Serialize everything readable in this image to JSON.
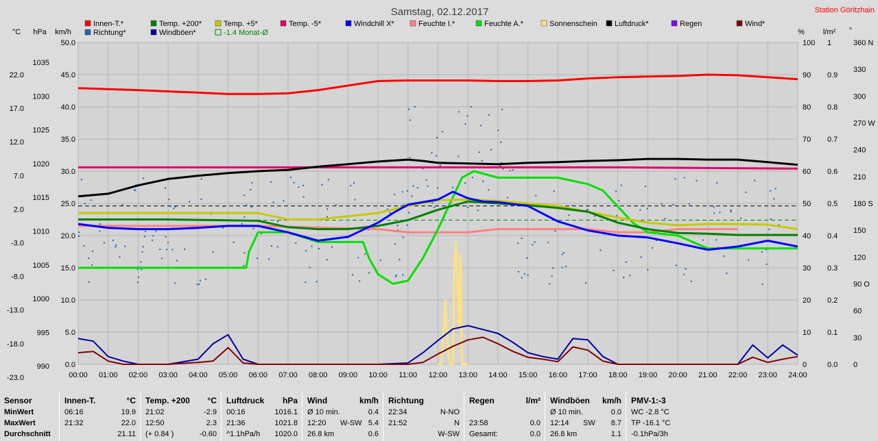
{
  "title": "Samstag, 02.12.2017",
  "station": "Station Göritzhain",
  "colors": {
    "innen": "#ff0000",
    "temp200": "#008000",
    "temp5": "#c8c800",
    "temp_minus5": "#e0006e",
    "windchill": "#0000ff",
    "feuchte_i": "#ff8080",
    "feuchte_a": "#00e000",
    "sonne": "#ffe080",
    "luftdruck": "#000000",
    "regen": "#8000ff",
    "wind": "#800000",
    "richtung": "#1e64b4",
    "windboeen": "#0000a0",
    "monat": "#008000",
    "ref_line": "#000000"
  },
  "legend": [
    {
      "label": "Innen-T.*",
      "color": "#ff0000"
    },
    {
      "label": "Temp. +200*",
      "color": "#008000"
    },
    {
      "label": "Temp. +5*",
      "color": "#c8c800"
    },
    {
      "label": "Temp. -5*",
      "color": "#e0006e"
    },
    {
      "label": "Windchill X*",
      "color": "#0000ff"
    },
    {
      "label": "Feuchte I.*",
      "color": "#ff8080"
    },
    {
      "label": "Feuchte A.*",
      "color": "#00e000"
    },
    {
      "label": "Sonnenschein",
      "color": "#ffe080"
    },
    {
      "label": "Luftdruck*",
      "color": "#000000"
    },
    {
      "label": "Regen",
      "color": "#8000ff"
    },
    {
      "label": "Wind*",
      "color": "#800000"
    },
    {
      "label": "Richtung*",
      "color": "#1e64b4"
    },
    {
      "label": "Windböen*",
      "color": "#0000a0"
    },
    {
      "label": "-1.4 Monat-Ø",
      "color": "#008000"
    }
  ],
  "axes": {
    "left_units": [
      "°C",
      "hPa",
      "km/h"
    ],
    "right_units": [
      "%",
      "l/m²",
      "°"
    ],
    "temp_ticks": [
      "22.0",
      "17.0",
      "12.0",
      "7.0",
      "2.0",
      "-3.0",
      "-8.0",
      "-13.0",
      "-18.0",
      "-23.0"
    ],
    "hpa_ticks": [
      "1035",
      "1030",
      "1025",
      "1020",
      "1015",
      "1010",
      "1005",
      "1000",
      "995",
      "990"
    ],
    "kmh_ticks": [
      "50.0",
      "45.0",
      "40.0",
      "35.0",
      "30.0",
      "25.0",
      "20.0",
      "15.0",
      "10.0",
      "5.0",
      "0.0"
    ],
    "pct_ticks": [
      "100",
      "90",
      "80",
      "70",
      "60",
      "50",
      "40",
      "30",
      "20",
      "10",
      "0"
    ],
    "rain_ticks": [
      "1",
      "0.9",
      "0.8",
      "0.7",
      "0.6",
      "0.5",
      "0.4",
      "0.3",
      "0.2",
      "0.1",
      "0.0"
    ],
    "deg_ticks": [
      "360 N",
      "330",
      "300",
      "270 W",
      "240",
      "210",
      "180 S",
      "150",
      "120",
      "90 O",
      "60",
      "30",
      "0"
    ],
    "x_ticks": [
      "00:00",
      "01:00",
      "02:00",
      "03:00",
      "04:00",
      "05:00",
      "06:00",
      "07:00",
      "08:00",
      "09:00",
      "10:00",
      "11:00",
      "12:00",
      "13:00",
      "14:00",
      "15:00",
      "16:00",
      "17:00",
      "18:00",
      "19:00",
      "20:00",
      "21:00",
      "22:00",
      "23:00",
      "24:00"
    ]
  },
  "chart_data": {
    "type": "line",
    "title": "Samstag, 02.12.2017",
    "x_unit": "hour",
    "xlim": [
      0,
      24
    ],
    "ylim_kmh": [
      0,
      50
    ],
    "ylim_temp": [
      -23,
      27
    ],
    "ylim_hpa": [
      990,
      1040
    ],
    "ylim_pct": [
      0,
      100
    ],
    "reference_lines": [
      {
        "value_kmh": 24.6,
        "style": "dashed"
      },
      {
        "value_kmh": 22.4,
        "style": "dashed",
        "color": "#008000"
      }
    ],
    "series": [
      {
        "name": "Innen-T.*",
        "unit": "°C",
        "x": [
          0,
          2,
          4,
          5,
          6,
          7,
          8,
          9,
          10,
          11,
          12,
          13,
          14,
          15,
          16,
          17,
          18,
          19,
          20,
          21,
          22,
          23,
          24
        ],
        "y": [
          19.9,
          19.6,
          19.2,
          19.0,
          19.0,
          19.1,
          19.6,
          20.3,
          21.0,
          21.1,
          21.1,
          21.1,
          21.0,
          21.0,
          21.1,
          21.4,
          21.6,
          21.7,
          21.8,
          22.0,
          21.9,
          21.6,
          21.3
        ]
      },
      {
        "name": "Luftdruck*",
        "unit": "hPa",
        "x": [
          0,
          1,
          2,
          3,
          4,
          5,
          6,
          7,
          8,
          9,
          10,
          11,
          11.5,
          12,
          13,
          14,
          15,
          16,
          17,
          18,
          19,
          20,
          21,
          22,
          23,
          24
        ],
        "y": [
          1016.1,
          1016.5,
          1017.8,
          1018.8,
          1019.3,
          1019.7,
          1020.0,
          1020.2,
          1020.7,
          1021.1,
          1021.5,
          1021.8,
          1021.6,
          1021.3,
          1021.2,
          1021.1,
          1021.3,
          1021.4,
          1021.6,
          1021.7,
          1021.9,
          1021.9,
          1021.8,
          1021.8,
          1021.4,
          1021.0
        ]
      },
      {
        "name": "Temp. -5*",
        "unit": "°C",
        "x": [
          0,
          6,
          12,
          18,
          24
        ],
        "y": [
          7.6,
          7.6,
          7.6,
          7.6,
          7.4
        ]
      },
      {
        "name": "Temp. +5*",
        "unit": "°C",
        "x": [
          0,
          3,
          6,
          7,
          8,
          9,
          10,
          11,
          12,
          13,
          14,
          15,
          16,
          17,
          18,
          19,
          20,
          21,
          22,
          23,
          24
        ],
        "y": [
          0.5,
          0.5,
          0.5,
          -0.5,
          -0.5,
          0.0,
          0.5,
          1.6,
          2.5,
          2.6,
          2.4,
          2.0,
          1.6,
          0.7,
          -0.2,
          -1.0,
          -1.4,
          -1.2,
          -1.2,
          -1.3,
          -2.0
        ]
      },
      {
        "name": "Temp. +200*",
        "unit": "°C",
        "x": [
          0,
          3,
          6,
          7,
          8,
          9,
          10,
          11,
          12,
          13,
          14,
          15,
          16,
          17,
          18,
          19,
          20,
          21,
          22,
          23,
          24
        ],
        "y": [
          -0.5,
          -0.5,
          -0.7,
          -1.7,
          -2.0,
          -2.0,
          -1.5,
          -0.6,
          1.0,
          2.3,
          2.0,
          1.7,
          1.3,
          0.7,
          -1.0,
          -2.0,
          -2.6,
          -2.7,
          -2.9,
          -2.9,
          -2.9
        ]
      },
      {
        "name": "Windchill X*",
        "unit": "°C",
        "x": [
          0,
          1,
          2,
          3,
          4,
          5,
          6,
          7,
          8,
          9,
          10,
          10.5,
          11,
          11.5,
          12,
          12.5,
          13,
          13.5,
          14,
          15,
          16,
          17,
          18,
          19,
          20,
          21,
          22,
          23,
          24
        ],
        "y": [
          -1.2,
          -1.8,
          -2.0,
          -2.0,
          -1.8,
          -1.5,
          -1.5,
          -2.5,
          -3.8,
          -3.2,
          -1.0,
          0.5,
          1.8,
          2.2,
          2.6,
          3.8,
          2.8,
          2.3,
          2.2,
          1.6,
          -0.8,
          -2.2,
          -3.0,
          -3.3,
          -4.2,
          -5.2,
          -4.7,
          -3.8,
          -4.7
        ]
      },
      {
        "name": "Feuchte I.*",
        "unit": "%",
        "x": [
          0,
          6,
          10,
          11,
          12,
          13,
          14,
          15,
          16,
          17,
          18,
          19,
          20,
          21,
          22
        ],
        "y": [
          43,
          43,
          42,
          41,
          41,
          41,
          42,
          42,
          42,
          42,
          41,
          41,
          42,
          42,
          42
        ]
      },
      {
        "name": "Feuchte A.*",
        "unit": "%",
        "x": [
          0,
          5.6,
          5.7,
          6,
          7,
          8,
          9,
          9.5,
          9.7,
          10,
          10.5,
          11,
          11.5,
          12,
          12.5,
          12.8,
          13.2,
          14,
          15,
          16,
          16.5,
          17,
          17.5,
          18,
          18.5,
          19,
          20,
          21,
          22,
          23,
          24
        ],
        "y": [
          30,
          30,
          35,
          41,
          41,
          38,
          38,
          38,
          33,
          28,
          25,
          26,
          33,
          42,
          52,
          58,
          60,
          58,
          58,
          58,
          57,
          56,
          54,
          49,
          44,
          41,
          40,
          36,
          36,
          36,
          36
        ]
      },
      {
        "name": "Wind*",
        "unit": "km/h",
        "x": [
          0,
          0.5,
          1,
          1.5,
          2,
          3,
          4,
          4.5,
          5,
          5.5,
          6,
          7,
          8,
          9,
          10,
          11,
          11.5,
          12,
          12.5,
          13,
          13.5,
          14,
          14.5,
          15,
          15.5,
          16,
          16.5,
          17,
          17.5,
          18,
          19,
          20,
          21,
          22,
          22.5,
          23,
          23.5,
          24
        ],
        "y": [
          1.8,
          2.0,
          0.5,
          0,
          0,
          0,
          0.3,
          0.5,
          2.6,
          0.2,
          0,
          0,
          0,
          0,
          0,
          0,
          0.3,
          1.6,
          2.8,
          3.8,
          4.2,
          3.2,
          2.0,
          1.1,
          0.8,
          0.4,
          2.7,
          2.2,
          0.5,
          0,
          0,
          0,
          0,
          0,
          1.1,
          0.3,
          0.8,
          1.2
        ]
      },
      {
        "name": "Windböen*",
        "unit": "km/h",
        "x": [
          0,
          0.5,
          1,
          1.5,
          2,
          3,
          4,
          4.5,
          5,
          5.5,
          6,
          7,
          8,
          9,
          10,
          11,
          11.5,
          12,
          12.5,
          13,
          13.5,
          14,
          14.5,
          15,
          15.5,
          16,
          16.5,
          17,
          17.5,
          18,
          19,
          20,
          21,
          22,
          22.5,
          23,
          23.5,
          24
        ],
        "y": [
          4.0,
          3.6,
          1.2,
          0.5,
          0,
          0,
          0.8,
          3.2,
          4.6,
          0.8,
          0,
          0,
          0,
          0,
          0,
          0.2,
          1.8,
          3.7,
          5.5,
          6.0,
          5.4,
          4.8,
          3.4,
          1.8,
          1.2,
          0.8,
          4.0,
          3.8,
          1.2,
          0,
          0,
          0,
          0,
          0,
          3.0,
          1.0,
          3.0,
          1.4
        ]
      },
      {
        "name": "Sonnenschein",
        "unit": "km/h-scale",
        "x": [
          12,
          12.1,
          12.2,
          12.25,
          12.3,
          12.4,
          12.5,
          12.55,
          12.6,
          12.7,
          12.75,
          12.8,
          12.9,
          13
        ],
        "y": [
          0,
          0,
          6,
          10,
          4,
          0,
          0,
          16,
          19,
          6,
          17,
          0,
          0,
          0
        ]
      }
    ]
  },
  "table": {
    "row_labels": {
      "header": "Sensor",
      "min": "MinWert",
      "max": "MaxWert",
      "avg": "Durchschnitt"
    },
    "columns": [
      {
        "title": "Innen-T.",
        "unit": "°C",
        "min": [
          "06:16",
          "19.9"
        ],
        "max": [
          "21:32",
          "22.0"
        ],
        "avg": [
          "",
          "21.11"
        ]
      },
      {
        "title": "Temp. +200",
        "unit": "°C",
        "min": [
          "21:02",
          "-2.9"
        ],
        "max": [
          "12:50",
          "2.3"
        ],
        "avg": [
          "(+ 0.84 )",
          "-0.60"
        ]
      },
      {
        "title": "Luftdruck",
        "unit": "hPa",
        "min": [
          "00:16",
          "1016.1"
        ],
        "max": [
          "21:36",
          "1021.8"
        ],
        "avg": [
          "^1.1hPa/h",
          "1020.0"
        ]
      },
      {
        "title": "Wind",
        "unit": "km/h",
        "min": [
          "Ø 10 min.",
          "",
          "0.4"
        ],
        "max": [
          "12:20",
          "W-SW",
          "5.4"
        ],
        "avg": [
          "26.8 km",
          "",
          "0.6"
        ]
      },
      {
        "title": "Richtung",
        "unit": "",
        "min": [
          "22:34",
          "N-NO"
        ],
        "max": [
          "21:52",
          "N"
        ],
        "avg": [
          "",
          "W-SW"
        ]
      },
      {
        "title": "Regen",
        "unit": "l/m²",
        "min": [
          "",
          ""
        ],
        "max": [
          "23:58",
          "0.0"
        ],
        "avg": [
          "Gesamt:",
          "0.0"
        ]
      },
      {
        "title": "Windböen",
        "unit": "km/h",
        "min": [
          "Ø 10 min.",
          "",
          "0.0"
        ],
        "max": [
          "12:14",
          "SW",
          "8.7"
        ],
        "avg": [
          "26.8 km",
          "",
          "1.1"
        ]
      },
      {
        "title": "PMV-1:-3",
        "unit": "",
        "min": [
          "WC -2.8 °C",
          ""
        ],
        "max": [
          "TP -16.1 °C",
          ""
        ],
        "avg": [
          "-0.1hPa/3h",
          ""
        ]
      }
    ]
  }
}
